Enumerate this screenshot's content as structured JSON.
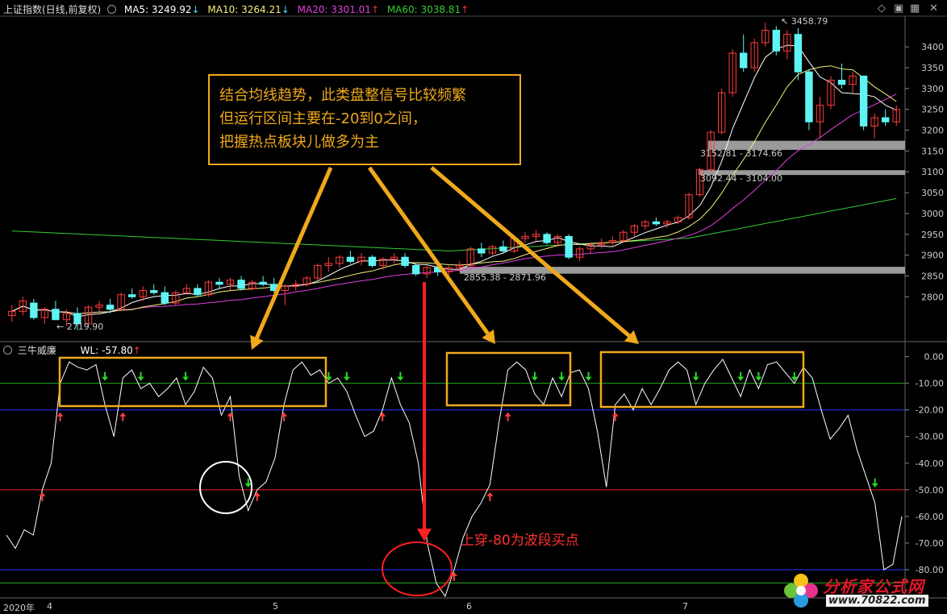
{
  "header": {
    "title": "上证指数(日线,前复权)",
    "ma5": {
      "label": "MA5: 3249.92",
      "color": "#ffffff",
      "arrow": "↓",
      "arrow_color": "#4dd9ff"
    },
    "ma10": {
      "label": "MA10: 3264.21",
      "color": "#f5f07a",
      "arrow": "↓",
      "arrow_color": "#4dd9ff"
    },
    "ma20": {
      "label": "MA20: 3301.01",
      "color": "#e040e0",
      "arrow": "↑",
      "arrow_color": "#ff3030"
    },
    "ma60": {
      "label": "MA60: 3038.81",
      "color": "#33cc33",
      "arrow": "↑",
      "arrow_color": "#ff3030"
    }
  },
  "indicator_header": {
    "title": "三牛威廉",
    "wl": "WL: -57.80",
    "arrow": "↑"
  },
  "annotations": {
    "box_lines": [
      "结合均线趋势，此类盘整信号比较频繁",
      "但运行区间主要在-20到0之间，",
      "把握热点板块儿做多为主"
    ],
    "buy_note": "上穿-80为波段买点"
  },
  "price_labels": {
    "high": "3458.79",
    "low": "2719.90",
    "zone1": "3152.81 - 3174.66",
    "zone2": "3092.44 - 3104.00",
    "zone3": "2855.38 - 2871.96"
  },
  "x_axis": {
    "year": "2020年",
    "months": [
      "4",
      "5",
      "6",
      "7"
    ]
  },
  "watermark": {
    "title": "分析家公式网",
    "url": "www.70822.com"
  },
  "colors": {
    "up": "#ff3b3b",
    "down": "#5ff4f4",
    "ma5": "#ffffff",
    "ma10": "#f5f07a",
    "ma20": "#e040e0",
    "ma60": "#33cc33",
    "annotation": "#f0a91b",
    "highlight_red": "#ff2020"
  },
  "chart_data": [
    {
      "type": "candlestick",
      "title": "上证指数(日线,前复权)",
      "y_ticks": [
        2800,
        2850,
        2900,
        2950,
        3000,
        3050,
        3100,
        3150,
        3200,
        3250,
        3300,
        3350,
        3400
      ],
      "ylim": [
        2700,
        3470
      ],
      "ohlc": [
        [
          2755,
          2780,
          2740,
          2765
        ],
        [
          2765,
          2800,
          2755,
          2790
        ],
        [
          2785,
          2795,
          2745,
          2750
        ],
        [
          2750,
          2775,
          2735,
          2770
        ],
        [
          2770,
          2790,
          2760,
          2745
        ],
        [
          2745,
          2770,
          2730,
          2760
        ],
        [
          2760,
          2775,
          2719.9,
          2735
        ],
        [
          2735,
          2780,
          2730,
          2775
        ],
        [
          2775,
          2790,
          2765,
          2780
        ],
        [
          2780,
          2795,
          2760,
          2770
        ],
        [
          2770,
          2810,
          2765,
          2805
        ],
        [
          2805,
          2820,
          2795,
          2800
        ],
        [
          2800,
          2825,
          2790,
          2815
        ],
        [
          2815,
          2830,
          2805,
          2810
        ],
        [
          2810,
          2825,
          2780,
          2785
        ],
        [
          2785,
          2815,
          2780,
          2810
        ],
        [
          2810,
          2830,
          2805,
          2820
        ],
        [
          2820,
          2830,
          2800,
          2805
        ],
        [
          2805,
          2840,
          2800,
          2835
        ],
        [
          2835,
          2845,
          2820,
          2830
        ],
        [
          2830,
          2845,
          2815,
          2840
        ],
        [
          2840,
          2850,
          2815,
          2820
        ],
        [
          2820,
          2840,
          2815,
          2835
        ],
        [
          2835,
          2850,
          2825,
          2830
        ],
        [
          2830,
          2845,
          2810,
          2815
        ],
        [
          2815,
          2830,
          2780,
          2825
        ],
        [
          2825,
          2840,
          2815,
          2830
        ],
        [
          2830,
          2850,
          2825,
          2845
        ],
        [
          2845,
          2880,
          2840,
          2875
        ],
        [
          2875,
          2895,
          2860,
          2880
        ],
        [
          2880,
          2900,
          2870,
          2895
        ],
        [
          2895,
          2910,
          2880,
          2885
        ],
        [
          2885,
          2905,
          2875,
          2895
        ],
        [
          2895,
          2900,
          2870,
          2875
        ],
        [
          2875,
          2895,
          2865,
          2890
        ],
        [
          2890,
          2905,
          2880,
          2895
        ],
        [
          2895,
          2905,
          2870,
          2875
        ],
        [
          2875,
          2880,
          2850,
          2855
        ],
        [
          2855,
          2875,
          2845,
          2870
        ],
        [
          2870,
          2880,
          2850,
          2860
        ],
        [
          2860,
          2875,
          2845,
          2870
        ],
        [
          2870,
          2885,
          2860,
          2875
        ],
        [
          2875,
          2920,
          2870,
          2915
        ],
        [
          2915,
          2930,
          2895,
          2905
        ],
        [
          2905,
          2925,
          2900,
          2920
        ],
        [
          2920,
          2935,
          2905,
          2910
        ],
        [
          2910,
          2945,
          2905,
          2940
        ],
        [
          2940,
          2955,
          2930,
          2945
        ],
        [
          2945,
          2960,
          2935,
          2950
        ],
        [
          2950,
          2955,
          2925,
          2930
        ],
        [
          2930,
          2950,
          2920,
          2945
        ],
        [
          2945,
          2950,
          2890,
          2895
        ],
        [
          2895,
          2920,
          2885,
          2915
        ],
        [
          2915,
          2930,
          2905,
          2925
        ],
        [
          2925,
          2940,
          2915,
          2930
        ],
        [
          2930,
          2945,
          2920,
          2935
        ],
        [
          2935,
          2960,
          2930,
          2955
        ],
        [
          2955,
          2975,
          2945,
          2970
        ],
        [
          2970,
          2985,
          2960,
          2980
        ],
        [
          2980,
          2990,
          2970,
          2975
        ],
        [
          2975,
          2985,
          2965,
          2980
        ],
        [
          2980,
          2995,
          2975,
          2990
        ],
        [
          2990,
          3050,
          2985,
          3045
        ],
        [
          3045,
          3110,
          3040,
          3105
        ],
        [
          3105,
          3200,
          3100,
          3195
        ],
        [
          3195,
          3300,
          3190,
          3290
        ],
        [
          3290,
          3395,
          3280,
          3385
        ],
        [
          3385,
          3430,
          3340,
          3350
        ],
        [
          3350,
          3420,
          3340,
          3410
        ],
        [
          3410,
          3458.79,
          3400,
          3440
        ],
        [
          3440,
          3450,
          3380,
          3390
        ],
        [
          3390,
          3440,
          3370,
          3430
        ],
        [
          3430,
          3445,
          3320,
          3340
        ],
        [
          3340,
          3345,
          3200,
          3220
        ],
        [
          3220,
          3280,
          3180,
          3260
        ],
        [
          3260,
          3330,
          3250,
          3320
        ],
        [
          3320,
          3360,
          3300,
          3310
        ],
        [
          3310,
          3340,
          3290,
          3330
        ],
        [
          3330,
          3330,
          3200,
          3210
        ],
        [
          3210,
          3240,
          3180,
          3230
        ],
        [
          3230,
          3250,
          3210,
          3220
        ],
        [
          3220,
          3260,
          3210,
          3250
        ]
      ],
      "zones": [
        [
          3152.81,
          3174.66
        ],
        [
          3092.44,
          3104.0
        ],
        [
          2855.38,
          2871.96
        ]
      ]
    },
    {
      "type": "line",
      "title": "三牛威廉",
      "series": [
        {
          "name": "WL",
          "values": [
            -67,
            -72,
            -65,
            -67,
            -50,
            -40,
            -10,
            -2,
            -4,
            -5,
            -3,
            -18,
            -30,
            -8,
            -5,
            -12,
            -10,
            -15,
            -12,
            -8,
            -18,
            -13,
            -4,
            -8,
            -22,
            -15,
            -45,
            -57.8,
            -50,
            -47,
            -38,
            -18,
            -5,
            -2,
            -7,
            -5,
            -10,
            -8,
            -13,
            -22,
            -30,
            -28,
            -20,
            -8,
            -18,
            -25,
            -40,
            -70,
            -85,
            -90,
            -80,
            -68,
            -60,
            -55,
            -48,
            -25,
            -5,
            -2,
            -5,
            -14,
            -18,
            -8,
            -15,
            -6,
            -5,
            -12,
            -28,
            -49,
            -18,
            -14,
            -20,
            -12,
            -18,
            -12,
            -5,
            -2,
            -5,
            -18,
            -10,
            -5,
            -1,
            -8,
            -15,
            -5,
            -12,
            -3,
            -2,
            -6,
            -10,
            -4,
            -8,
            -20,
            -31,
            -27,
            -22,
            -35,
            -45,
            -55,
            -80,
            -78,
            -60
          ]
        }
      ],
      "y_ticks": [
        0,
        -10,
        -20,
        -30,
        -40,
        -50,
        -60,
        -70,
        -80
      ],
      "ylim": [
        -90,
        2
      ],
      "reference_lines": [
        -10,
        -20,
        -50,
        -80,
        -85
      ]
    }
  ]
}
